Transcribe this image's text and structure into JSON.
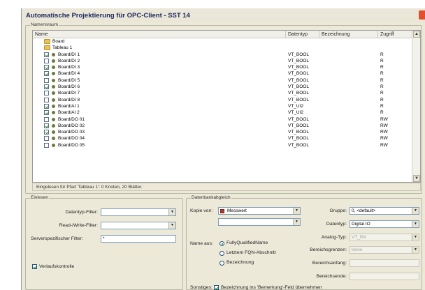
{
  "window": {
    "title": "Automatische Projektierung für OPC-Client - SST 14"
  },
  "namespace": {
    "legend": "Namensraum",
    "columns": {
      "name": "Name",
      "type": "Datentyp",
      "designation": "Bezeichnung",
      "access": "Zugriff"
    },
    "folders": [
      {
        "label": "Board"
      },
      {
        "label": "Tableau 1"
      }
    ],
    "items": [
      {
        "name": "Board/DI 1",
        "type": "VT_BOOL",
        "access": "R",
        "checked": true
      },
      {
        "name": "Board/DI 2",
        "type": "VT_BOOL",
        "access": "R",
        "checked": false
      },
      {
        "name": "Board/DI 3",
        "type": "VT_BOOL",
        "access": "R",
        "checked": true
      },
      {
        "name": "Board/DI 4",
        "type": "VT_BOOL",
        "access": "R",
        "checked": true
      },
      {
        "name": "Board/DI 5",
        "type": "VT_BOOL",
        "access": "R",
        "checked": false
      },
      {
        "name": "Board/DI 6",
        "type": "VT_BOOL",
        "access": "R",
        "checked": true
      },
      {
        "name": "Board/DI 7",
        "type": "VT_BOOL",
        "access": "R",
        "checked": false
      },
      {
        "name": "Board/DI 8",
        "type": "VT_BOOL",
        "access": "R",
        "checked": false
      },
      {
        "name": "Board/AI 1",
        "type": "VT_UI2",
        "access": "R",
        "checked": true
      },
      {
        "name": "Board/AI 2",
        "type": "VT_UI2",
        "access": "R",
        "checked": true
      },
      {
        "name": "Board/DO 01",
        "type": "VT_BOOL",
        "access": "RW",
        "checked": false
      },
      {
        "name": "Board/DO 02",
        "type": "VT_BOOL",
        "access": "RW",
        "checked": true
      },
      {
        "name": "Board/DO 03",
        "type": "VT_BOOL",
        "access": "RW",
        "checked": true
      },
      {
        "name": "Board/DO 04",
        "type": "VT_BOOL",
        "access": "RW",
        "checked": false
      },
      {
        "name": "Board/DO 05",
        "type": "VT_BOOL",
        "access": "RW",
        "checked": false
      }
    ],
    "status": "Eingelesen für Pfad 'Tableau 1': 0 Knoten, 20 Blätter."
  },
  "read_in": {
    "legend": "Einlesen",
    "datatype_filter_label": "Datentyp-Filter:",
    "datatype_filter_value": "",
    "rw_filter_label": "Read-/Write-Filter:",
    "rw_filter_value": "",
    "server_filter_label": "Serverspezifischer Filter:",
    "server_filter_value": "*",
    "history_label": "Verlaufskontrolle",
    "history_checked": true
  },
  "db_compare": {
    "legend": "Datenbankabgleich",
    "copy_from_label": "Kopie von:",
    "copy_from_value": "Messwert",
    "copy_from_second_value": "",
    "name_from_label": "Name aus:",
    "name_options": [
      {
        "label": "FullyQualifiedName",
        "selected": true
      },
      {
        "label": "Letztem FQN-Abschnitt",
        "selected": false
      },
      {
        "label": "Bezeichnung",
        "selected": false
      }
    ],
    "group_label": "Gruppe:",
    "group_value": "0, <default>",
    "datatype_label": "Datentyp:",
    "datatype_value": "Digital IO",
    "analog_label": "Analog-Typ:",
    "analog_value": "VT_R4",
    "ranges_label": "Bereichsgrenzen:",
    "ranges_value": "keine",
    "range_start_label": "Bereichsanfang:",
    "range_start_value": "",
    "range_end_label": "Bereichsende:",
    "range_end_value": "",
    "misc_label": "Sonstiges:",
    "misc_checkbox_label": "Bezeichnung ins 'Bemerkung'-Feld übernehmen",
    "misc_checked": true
  }
}
